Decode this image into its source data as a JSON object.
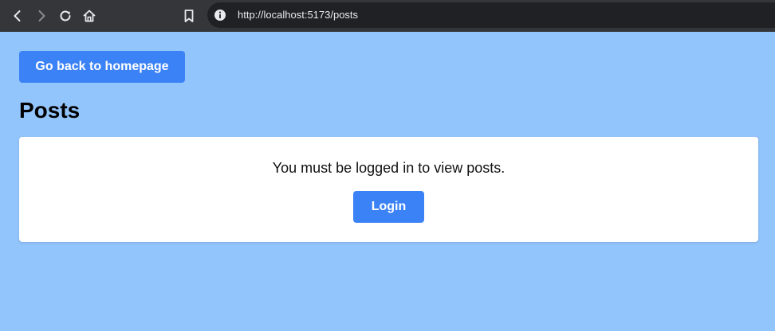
{
  "browser": {
    "url": "http://localhost:5173/posts",
    "icons": {
      "back": "arrow-left-icon",
      "forward": "arrow-right-icon",
      "reload": "reload-icon",
      "home": "home-icon",
      "bookmark": "bookmark-icon",
      "info": "info-icon"
    }
  },
  "page": {
    "back_button_label": "Go back to homepage",
    "title": "Posts",
    "message": "You must be logged in to view posts.",
    "login_button_label": "Login"
  },
  "colors": {
    "page_background": "#93c5fd",
    "button_primary": "#3b82f6",
    "browser_chrome": "#35363a",
    "address_bar": "#202124"
  }
}
